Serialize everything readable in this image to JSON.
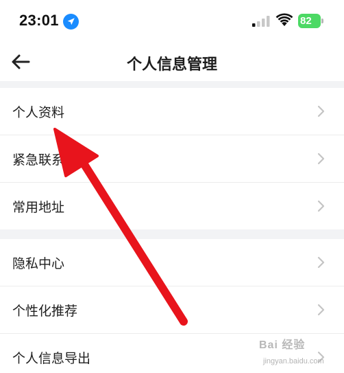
{
  "status_bar": {
    "time": "23:01",
    "battery": "82",
    "location_icon": "location-arrow-icon",
    "signal_icon": "cellular-signal-icon",
    "wifi_icon": "wifi-icon"
  },
  "nav": {
    "title": "个人信息管理",
    "back_icon": "back-arrow-icon"
  },
  "menu_groups": [
    {
      "items": [
        {
          "label": "个人资料"
        },
        {
          "label": "紧急联系人"
        },
        {
          "label": "常用地址"
        }
      ]
    },
    {
      "items": [
        {
          "label": "隐私中心"
        },
        {
          "label": "个性化推荐"
        },
        {
          "label": "个人信息导出"
        }
      ]
    }
  ],
  "annotation": {
    "color": "#e8141c"
  },
  "watermark": {
    "brand": "Bai 经验",
    "url": "jingyan.baidu.com"
  },
  "colors": {
    "battery": "#4cd964",
    "separator": "#f2f3f5",
    "chevron": "#c4c4c4"
  }
}
